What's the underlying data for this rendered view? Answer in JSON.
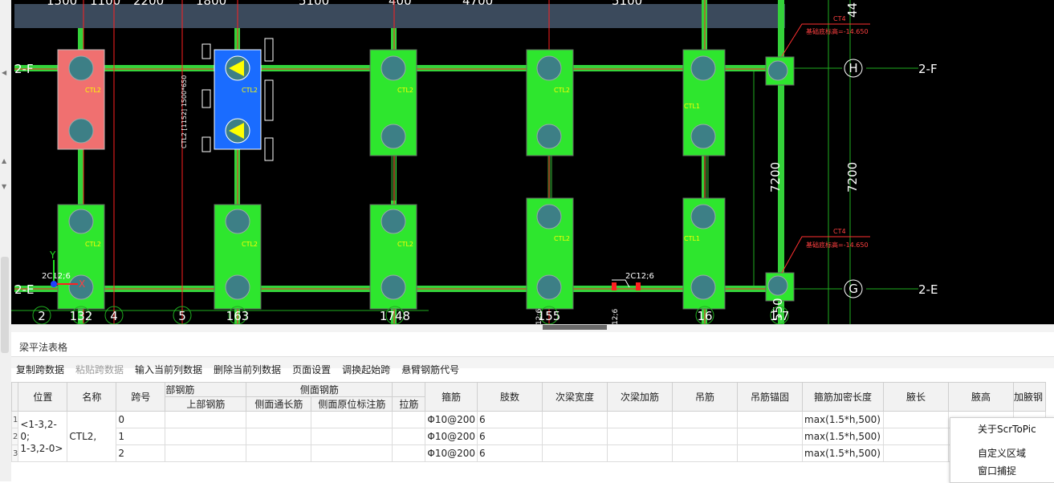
{
  "cad": {
    "top_dims": [
      "1500",
      "1100",
      "2200",
      "1800",
      "5100",
      "400",
      "4700",
      "5100"
    ],
    "right_dims": {
      "top_vertical": "44",
      "mid_left": "7200",
      "mid_right": "7200"
    },
    "axis_labels": {
      "h_circle": "H",
      "g_circle": "G",
      "row_2f": "2-F",
      "row_2e": "2-E",
      "left_2f": "2-F",
      "left_2e": "2-E"
    },
    "bottom_axis": {
      "c2": "2",
      "c132": "132",
      "c4": "4",
      "c5": "5",
      "c163": "163",
      "c1748": "1748",
      "c155": "155",
      "c16": "16",
      "c7": "1-7",
      "c550": "550"
    },
    "cap_label_ctl2": "CTL2",
    "cap_label_ctl1": "CTL1",
    "ct4_label": "CT4",
    "elev_label": "基础底标高=-14.650",
    "beam_labels": {
      "left": "2C12;6",
      "right": "2C12;6",
      "v1": "12;6",
      "v2": "12;6"
    },
    "vtext": "CTL2 [1152] 1500*650",
    "ucs": {
      "x": "X",
      "y": "Y"
    }
  },
  "panel": {
    "title": "梁平法表格",
    "toolbar": {
      "copy": "复制跨数据",
      "paste": "粘贴跨数据",
      "input_col": "输入当前列数据",
      "delete_col": "删除当前列数据",
      "page_setup": "页面设置",
      "swap_start": "调换起始跨",
      "cantilever": "悬臂钢筋代号"
    },
    "headers": {
      "pos": "位置",
      "name": "名称",
      "span": "跨号",
      "top_group": "部钢筋",
      "top_rebar": "上部钢筋",
      "side_group": "侧面钢筋",
      "side_long": "侧面通长筋",
      "side_local": "侧面原位标注筋",
      "tie": "拉筋",
      "stirrup": "箍筋",
      "legs": "肢数",
      "sec_width": "次梁宽度",
      "sec_add": "次梁加筋",
      "hanger": "吊筋",
      "hanger_anchor": "吊筋锚固",
      "dense_len": "箍筋加密长度",
      "haunch_len": "腋长",
      "haunch_h": "腋高",
      "haunch_rebar": "加腋钢"
    },
    "rows": [
      {
        "n": "1",
        "span": "0",
        "stirrup": "Φ10@200",
        "legs": "6",
        "dense": "max(1.5*h,500)"
      },
      {
        "n": "2",
        "span": "1",
        "stirrup": "Φ10@200",
        "legs": "6",
        "dense": "max(1.5*h,500)"
      },
      {
        "n": "3",
        "span": "2",
        "stirrup": "Φ10@200",
        "legs": "6",
        "dense": "max(1.5*h,500)"
      }
    ],
    "position_value": "<1-3,2-0;\n1-3,2-0>",
    "name_value": "CTL2,"
  },
  "context_menu": {
    "about": "关于ScrToPic",
    "custom_region": "自定义区域",
    "window_capture": "窗口捕捉"
  },
  "colors": {
    "cad_bg": "#000000",
    "beam_green": "#34d23a",
    "pile_cap_green": "#2ee62e",
    "selected_red": "#f07070",
    "selected_blue": "#1a6cff",
    "grid_red": "#ff2020",
    "dim_green": "#1fae1f"
  }
}
